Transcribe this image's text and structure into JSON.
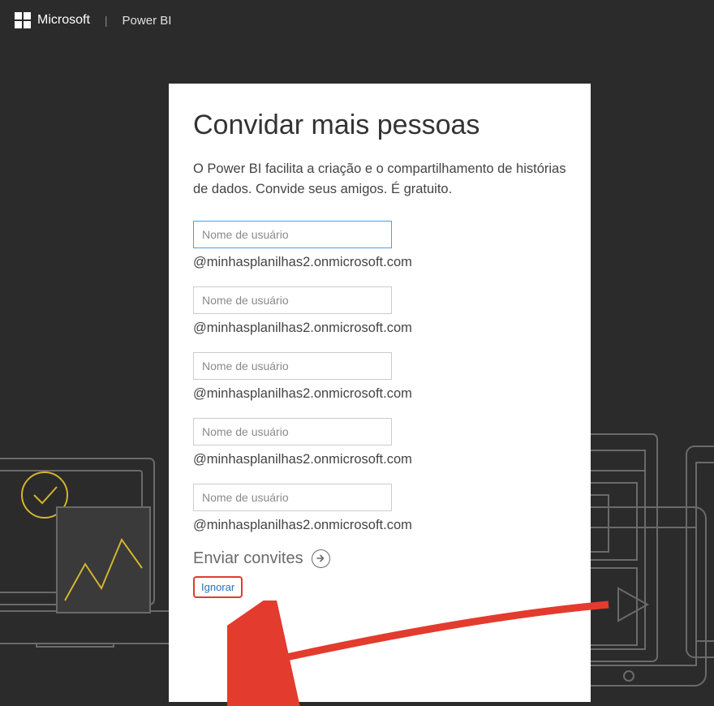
{
  "header": {
    "company": "Microsoft",
    "product": "Power BI"
  },
  "card": {
    "title": "Convidar mais pessoas",
    "subtitle": "O Power BI facilita a criação e o compartilhamento de histórias de dados. Convide seus amigos. É gratuito.",
    "placeholder": "Nome de usuário",
    "domain_suffix": "@minhasplanilhas2.onmicrosoft.com",
    "invite_count": 5,
    "send_label": "Enviar convites",
    "ignore_label": "Ignorar"
  }
}
